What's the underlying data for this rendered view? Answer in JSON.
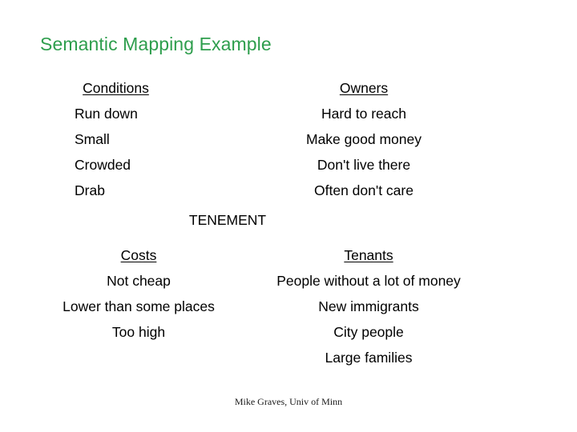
{
  "slide": {
    "title": "Semantic Mapping Example",
    "title_color": "#2e9e4d",
    "background_color": "#ffffff",
    "text_color": "#000000",
    "center_node": "TENEMENT",
    "credit": "Mike Graves, Univ of Minn"
  },
  "quadrants": {
    "conditions": {
      "heading": "Conditions",
      "items": [
        "Run down",
        "Small",
        "Crowded",
        "Drab"
      ]
    },
    "owners": {
      "heading": "Owners",
      "items": [
        "Hard to reach",
        "Make good money",
        "Don't live there",
        "Often don't care"
      ]
    },
    "costs": {
      "heading": "Costs",
      "items": [
        "Not cheap",
        "Lower than some places",
        "Too high"
      ]
    },
    "tenants": {
      "heading": "Tenants",
      "items": [
        "People without a lot of money",
        "New immigrants",
        "City people",
        "Large families"
      ]
    }
  }
}
